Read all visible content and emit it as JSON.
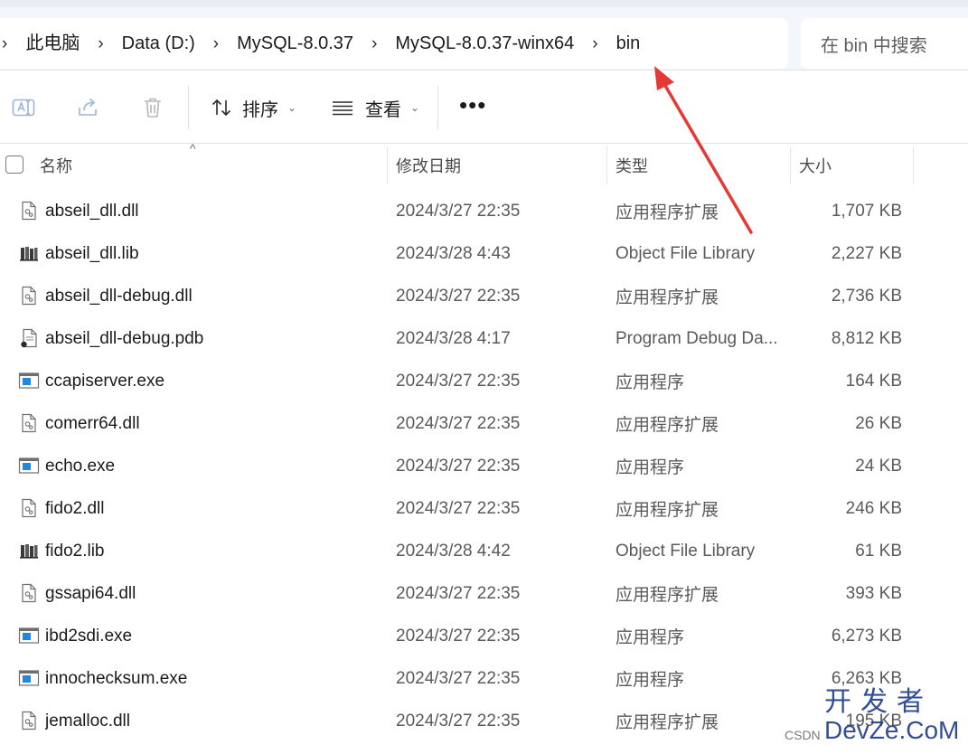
{
  "breadcrumb": {
    "items": [
      "此电脑",
      "Data (D:)",
      "MySQL-8.0.37",
      "MySQL-8.0.37-winx64",
      "bin"
    ]
  },
  "search": {
    "placeholder": "在 bin 中搜索"
  },
  "toolbar": {
    "sort_label": "排序",
    "view_label": "查看",
    "more_label": "•••"
  },
  "columns": {
    "name": "名称",
    "date": "修改日期",
    "type": "类型",
    "size": "大小"
  },
  "files": [
    {
      "name": "abseil_dll.dll",
      "date": "2024/3/27 22:35",
      "type": "应用程序扩展",
      "size": "1,707 KB",
      "icon": "dll-file-icon"
    },
    {
      "name": "abseil_dll.lib",
      "date": "2024/3/28 4:43",
      "type": "Object File Library",
      "size": "2,227 KB",
      "icon": "lib-file-icon"
    },
    {
      "name": "abseil_dll-debug.dll",
      "date": "2024/3/27 22:35",
      "type": "应用程序扩展",
      "size": "2,736 KB",
      "icon": "dll-file-icon"
    },
    {
      "name": "abseil_dll-debug.pdb",
      "date": "2024/3/28 4:17",
      "type": "Program Debug Da...",
      "size": "8,812 KB",
      "icon": "pdb-file-icon"
    },
    {
      "name": "ccapiserver.exe",
      "date": "2024/3/27 22:35",
      "type": "应用程序",
      "size": "164 KB",
      "icon": "exe-file-icon"
    },
    {
      "name": "comerr64.dll",
      "date": "2024/3/27 22:35",
      "type": "应用程序扩展",
      "size": "26 KB",
      "icon": "dll-file-icon"
    },
    {
      "name": "echo.exe",
      "date": "2024/3/27 22:35",
      "type": "应用程序",
      "size": "24 KB",
      "icon": "exe-file-icon"
    },
    {
      "name": "fido2.dll",
      "date": "2024/3/27 22:35",
      "type": "应用程序扩展",
      "size": "246 KB",
      "icon": "dll-file-icon"
    },
    {
      "name": "fido2.lib",
      "date": "2024/3/28 4:42",
      "type": "Object File Library",
      "size": "61 KB",
      "icon": "lib-file-icon"
    },
    {
      "name": "gssapi64.dll",
      "date": "2024/3/27 22:35",
      "type": "应用程序扩展",
      "size": "393 KB",
      "icon": "dll-file-icon"
    },
    {
      "name": "ibd2sdi.exe",
      "date": "2024/3/27 22:35",
      "type": "应用程序",
      "size": "6,273 KB",
      "icon": "exe-file-icon"
    },
    {
      "name": "innochecksum.exe",
      "date": "2024/3/27 22:35",
      "type": "应用程序",
      "size": "6,263 KB",
      "icon": "exe-file-icon"
    },
    {
      "name": "jemalloc.dll",
      "date": "2024/3/27 22:35",
      "type": "应用程序扩展",
      "size": "195 KB",
      "icon": "dll-file-icon"
    }
  ],
  "watermark": {
    "line1": "开发者",
    "line2": "DevZe.CoM",
    "small": "CSDN"
  },
  "colors": {
    "annotation_arrow": "#e53935",
    "exe_icon_blue": "#1e88e5",
    "address_bar_bg": "#f3f6fa",
    "watermark": "#1f3b8a"
  }
}
